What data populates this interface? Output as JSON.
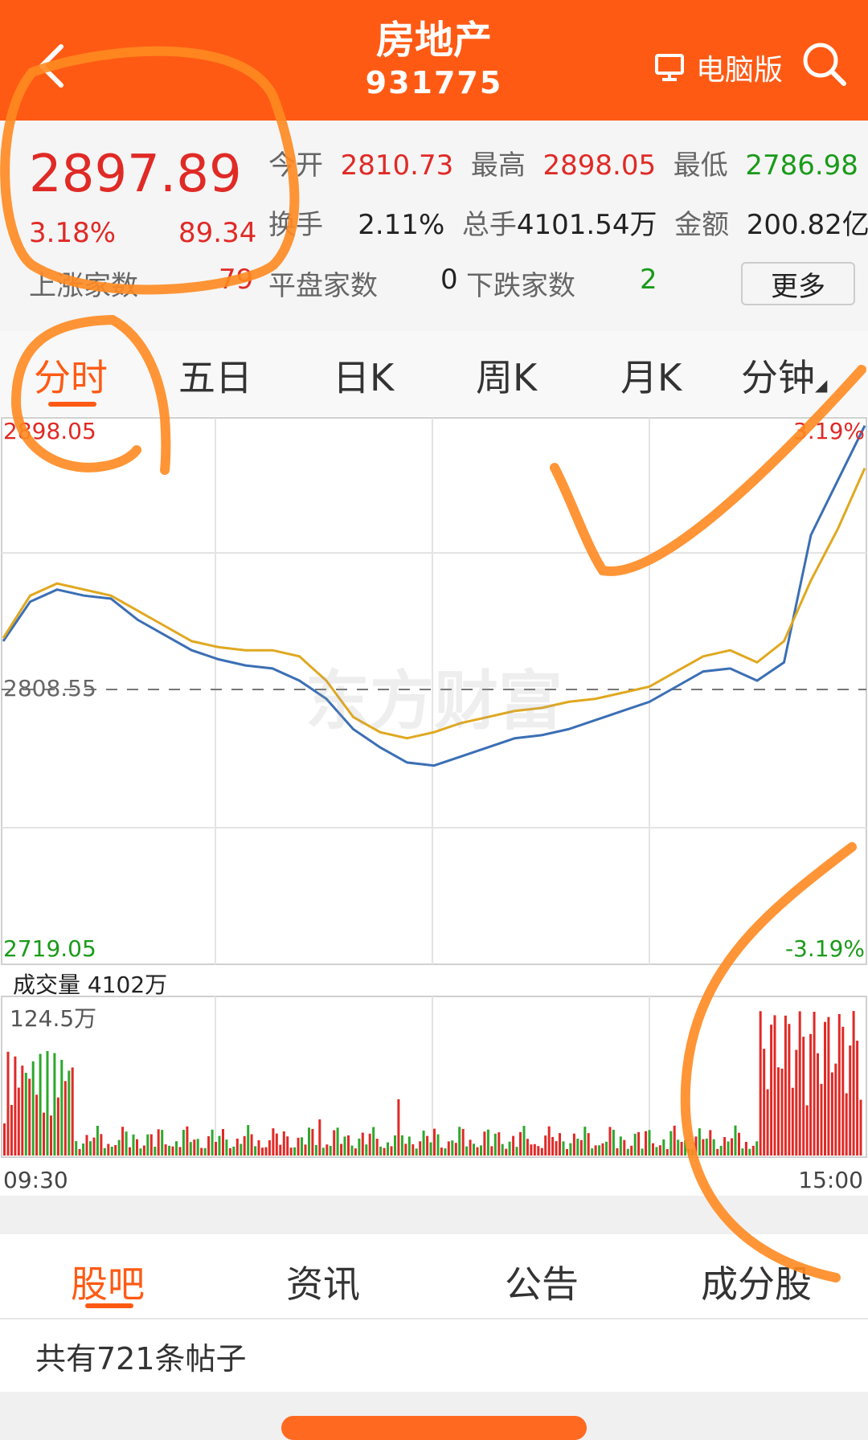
{
  "header": {
    "title": "房地产",
    "code": "931775",
    "pc_label": "电脑版"
  },
  "quote": {
    "price": "2897.89",
    "pct": "3.18%",
    "change": "89.34",
    "row1": {
      "open_label": "今开",
      "open": "2810.73",
      "high_label": "最高",
      "high": "2898.05",
      "low_label": "最低",
      "low": "2786.98"
    },
    "row2": {
      "turnover_label": "换手",
      "turnover": "2.11%",
      "volume_label": "总手",
      "volume": "4101.54万",
      "amount_label": "金额",
      "amount": "200.82亿"
    },
    "row3": {
      "up_label": "上涨家数",
      "up": "79",
      "flat_label": "平盘家数",
      "flat": "0",
      "down_label": "下跌家数",
      "down": "2"
    },
    "more_label": "更多"
  },
  "tabs": [
    "分时",
    "五日",
    "日K",
    "周K",
    "月K",
    "分钟"
  ],
  "chart": {
    "y_high": "2898.05",
    "y_high_pct": "3.19%",
    "y_mid": "2808.55",
    "y_low": "2719.05",
    "y_low_pct": "-3.19%",
    "volume_label": "成交量",
    "volume_total": "4102万",
    "volume_max": "124.5万",
    "x_start": "09:30",
    "x_end": "15:00",
    "watermark": "东方财富"
  },
  "chart_data": {
    "type": "line",
    "title": "",
    "xlabel": "",
    "ylabel": "",
    "x": [
      "09:30",
      "15:00"
    ],
    "ylim": [
      2719.05,
      2898.05
    ],
    "baseline": 2808.55,
    "series": [
      {
        "name": "",
        "color": "#3b6fb5",
        "values": [
          2825,
          2838,
          2842,
          2840,
          2839,
          2832,
          2827,
          2822,
          2819,
          2817,
          2816,
          2812,
          2806,
          2796,
          2790,
          2785,
          2784,
          2787,
          2790,
          2793,
          2794,
          2796,
          2799,
          2802,
          2805,
          2810,
          2815,
          2816,
          2812,
          2818,
          2860,
          2878,
          2896
        ]
      },
      {
        "name": "",
        "color": "#e0a820",
        "values": [
          2826,
          2840,
          2844,
          2842,
          2840,
          2835,
          2830,
          2825,
          2823,
          2822,
          2822,
          2820,
          2812,
          2800,
          2795,
          2793,
          2795,
          2798,
          2800,
          2802,
          2803,
          2805,
          2806,
          2808,
          2810,
          2815,
          2820,
          2822,
          2818,
          2825,
          2845,
          2862,
          2882
        ]
      }
    ],
    "volume": {
      "max": "124.5万",
      "colors": {
        "up": "#e02a26",
        "down": "#2ea82e"
      }
    }
  },
  "bottom_tabs": [
    "股吧",
    "资讯",
    "公告",
    "成分股"
  ],
  "posts_label": "共有721条帖子"
}
